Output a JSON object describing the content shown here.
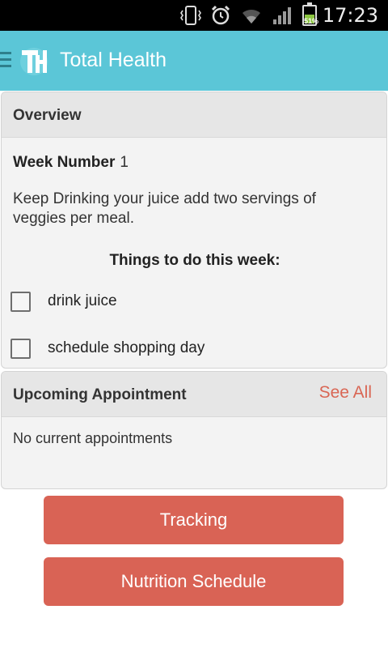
{
  "status_bar": {
    "time": "17:23",
    "battery_percent": "51%",
    "icons": [
      "vibrate-icon",
      "alarm-icon",
      "wifi-icon",
      "signal-icon",
      "battery-icon"
    ]
  },
  "app_bar": {
    "title": "Total Health",
    "logo_text": "TH",
    "color": "#5bc6d7"
  },
  "overview": {
    "heading": "Overview",
    "week_label": "Week Number",
    "week_value": "1",
    "description": "Keep Drinking your juice add two servings of veggies per meal.",
    "todo_heading": "Things to do this week:",
    "todos": [
      {
        "label": "drink juice",
        "checked": false
      },
      {
        "label": "schedule shopping day",
        "checked": false
      }
    ]
  },
  "appointments": {
    "heading": "Upcoming Appointment",
    "see_all": "See All",
    "empty_text": "No current appointments"
  },
  "buttons": {
    "tracking": "Tracking",
    "nutrition": "Nutrition Schedule",
    "color": "#d96355"
  }
}
